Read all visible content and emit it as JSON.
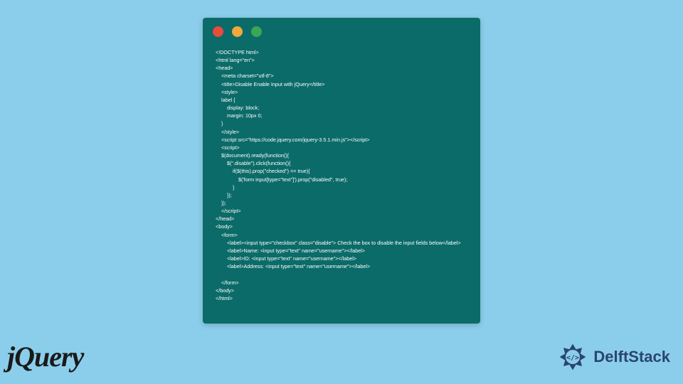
{
  "code": {
    "lines": [
      "<!DOCTYPE html>",
      "<html lang=\"en\">",
      "<head>",
      "    <meta charset=\"utf-8\">",
      "    <title>Disable Enable Input with jQuery</title>",
      "    <style>",
      "    label {",
      "        display: block;",
      "        margin: 10px 0;",
      "    }",
      "    </style>",
      "    <script src=\"https://code.jquery.com/jquery-3.5.1.min.js\"></script>",
      "    <script>",
      "    $(document).ready(function(){",
      "        $(\".disable\").click(function(){",
      "            if($(this).prop(\"checked\") == true){",
      "                $('form input[type=\"text\"]').prop(\"disabled\", true);",
      "            }",
      "        });",
      "    });",
      "    </script>",
      "</head>",
      "<body>",
      "    <form>",
      "        <label><input type=\"checkbox\" class=\"disable\"> Check the box to disable the input fields below</label>",
      "        <label>Name: <input type=\"text\" name=\"username\"></label>",
      "        <label>ID: <input type=\"text\" name=\"username\"></label>",
      "        <label>Address: <input type=\"text\" name=\"username\"></label>",
      "",
      "    </form>",
      "</body>",
      "</html>"
    ]
  },
  "logos": {
    "jquery": "jQuery",
    "delft": "DelftStack"
  }
}
